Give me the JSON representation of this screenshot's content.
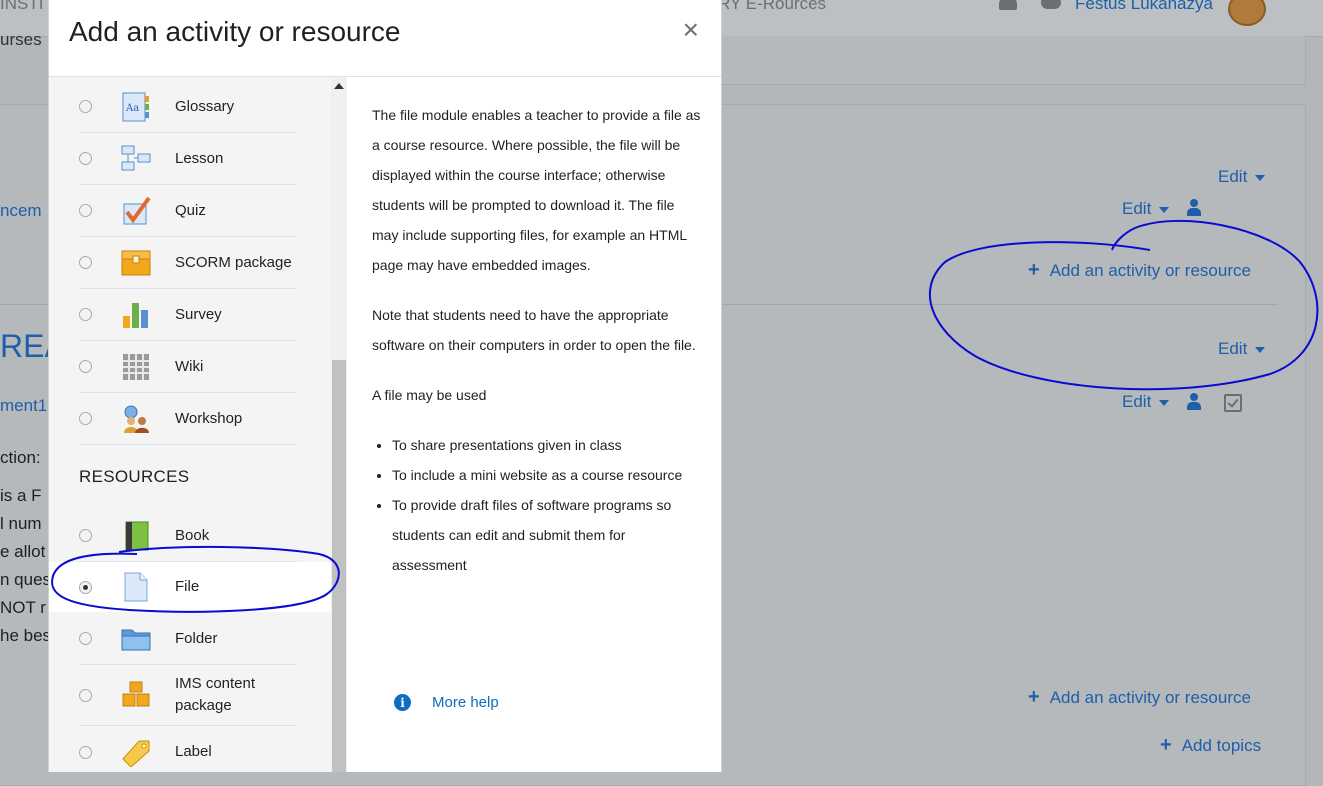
{
  "background": {
    "nav_fragment_left": "INSTI",
    "nav_fragment_right": "RY E-Rources",
    "user_name": "Festus Lukanazya",
    "breadcrumb_fragment": "urses",
    "announce_fragment": "ncem",
    "section_fragment": "REA",
    "assignment_fragment": "ment1",
    "body_lines": [
      "ction:",
      "is a F",
      "l num",
      "e allot",
      "n ques",
      "NOT r",
      "he bes"
    ],
    "edit_label": "Edit",
    "add_activity_label": "Add an activity or resource",
    "add_topics_label": "Add topics",
    "accent_color": "#1d5fa8",
    "annotation_color": "#0a0ad0"
  },
  "modal": {
    "title": "Add an activity or resource",
    "close_symbol": "×",
    "activities": [
      {
        "label": "Glossary",
        "icon": "glossary-icon"
      },
      {
        "label": "Lesson",
        "icon": "lesson-icon"
      },
      {
        "label": "Quiz",
        "icon": "quiz-icon"
      },
      {
        "label": "SCORM package",
        "icon": "scorm-package-icon"
      },
      {
        "label": "Survey",
        "icon": "survey-icon"
      },
      {
        "label": "Wiki",
        "icon": "wiki-icon"
      },
      {
        "label": "Workshop",
        "icon": "workshop-icon"
      }
    ],
    "resources_heading": "RESOURCES",
    "resources": [
      {
        "label": "Book",
        "icon": "book-icon"
      },
      {
        "label": "File",
        "icon": "file-icon",
        "selected": true
      },
      {
        "label": "Folder",
        "icon": "folder-icon"
      },
      {
        "label": "IMS content package",
        "icon": "ims-package-icon"
      },
      {
        "label": "Label",
        "icon": "label-icon"
      }
    ],
    "help": {
      "p1": "The file module enables a teacher to provide a file as a course resource. Where possible, the file will be displayed within the course interface; otherwise students will be prompted to download it. The file may include supporting files, for example an HTML page may have embedded images.",
      "p2": "Note that students need to have the appropriate software on their computers in order to open the file.",
      "p3": "A file may be used",
      "bullets": [
        "To share presentations given in class",
        "To include a mini website as a course resource",
        "To provide draft files of software programs so students can edit and submit them for assessment"
      ],
      "more_help": "More help"
    }
  }
}
